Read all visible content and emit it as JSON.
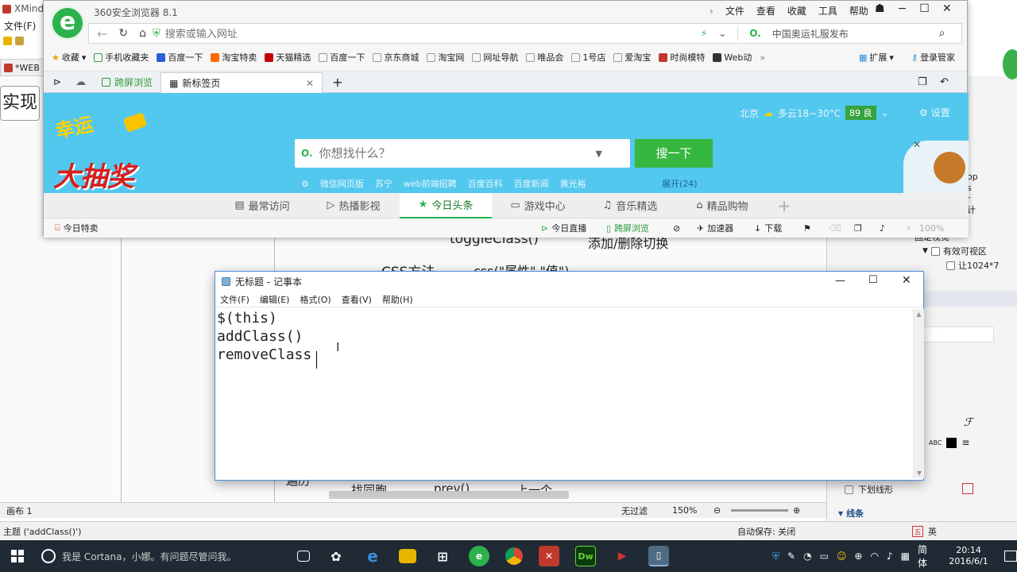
{
  "xmind": {
    "app_title": "XMind",
    "menu_file": "文件(F)",
    "left_tab": "*WEB",
    "canvas_text_left": "实现",
    "canvas_node_toggle": "toggleClass()",
    "canvas_node_toggle_desc": "添加/删除切换",
    "canvas_node_css": "CSS方法",
    "canvas_node_css_desc": "css(\"属性\",\"值\")",
    "canvas_node_bottom1": "遍历",
    "canvas_node_bottom2": "找同胞",
    "canvas_node_bottom3": "prev()",
    "canvas_node_bottom4": "上一个",
    "right_items": [
      "op",
      "s",
      "r",
      "计"
    ],
    "right_tree": [
      "固定视觉",
      "有效可视区",
      "让1024*7"
    ],
    "right_underline": "下划线形",
    "right_lines": "线条",
    "status_tab": "画布 1",
    "status_nofilter": "无过滤",
    "status_zoom": "150%",
    "bottom_topic": "主题 ('addClass()')",
    "bottom_autosave": "自动保存: 关闭"
  },
  "browser": {
    "title": "360安全浏览器 8.1",
    "menu": [
      "文件",
      "查看",
      "收藏",
      "工具",
      "帮助"
    ],
    "address_placeholder": "搜索或输入网址",
    "search_box": "中国奥运礼服发布",
    "bookmarks": [
      "收藏",
      "手机收藏夹",
      "百度一下",
      "淘宝特卖",
      "天猫精选",
      "百度一下",
      "京东商城",
      "淘宝网",
      "网址导航",
      "唯品会",
      "1号店",
      "爱淘宝",
      "时尚模特",
      "Web动"
    ],
    "bm_ext": "扩展",
    "bm_login": "登录管家",
    "tab_cross": "跨屏浏览",
    "tab_new": "新标签页",
    "weather": "北京",
    "weather_desc": "多云18~30°C",
    "aqi": "89 良",
    "settings": "设置",
    "promo": "大抽奖",
    "promo_top": "幸运",
    "search_placeholder": "你想找什么？",
    "search_button": "搜一下",
    "hot_links": [
      "微信网页版",
      "苏宁",
      "web前端招聘",
      "百度百科",
      "百度新闻",
      "黄光裕"
    ],
    "expand": "展开(24)",
    "quick_tabs": [
      "最常访问",
      "热播影视",
      "今日头条",
      "游戏中心",
      "音乐精选",
      "精品购物"
    ],
    "status_left": "今日特卖",
    "status_live": "今日直播",
    "status_cross": "跨屏浏览",
    "status_accel": "加速器",
    "status_download": "下载",
    "status_zoom": "100%"
  },
  "notepad": {
    "title": "无标题 - 记事本",
    "menu": [
      "文件(F)",
      "编辑(E)",
      "格式(O)",
      "查看(V)",
      "帮助(H)"
    ],
    "content": "$(this)\naddClass()\nremoveClass"
  },
  "taskbar": {
    "cortana": "我是 Cortana，小娜。有问题尽管问我。",
    "ime": "简体",
    "time": "20:14",
    "date": "2016/6/1",
    "ime_small": "英"
  }
}
